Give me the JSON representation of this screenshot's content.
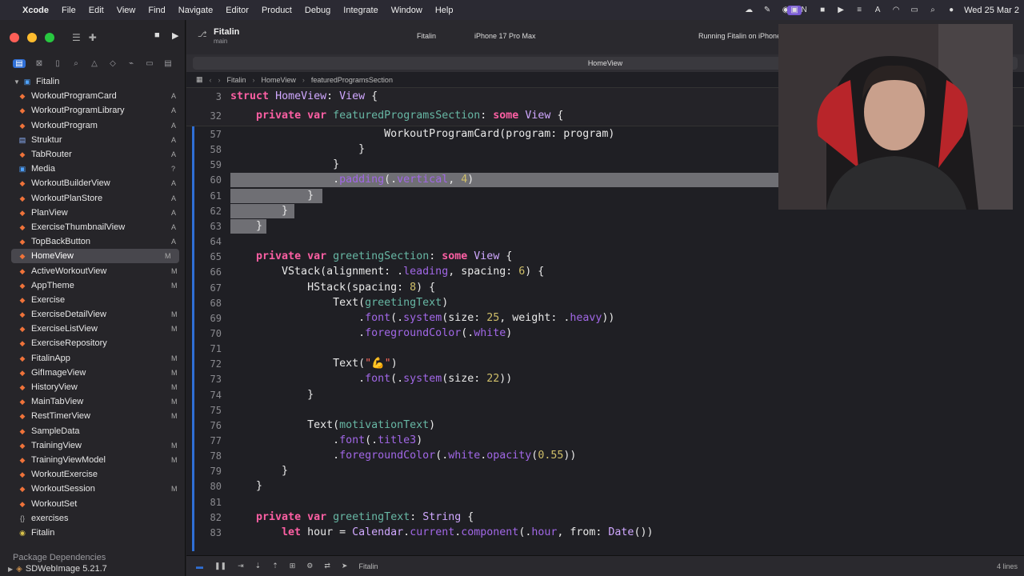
{
  "menubar": {
    "app": "Xcode",
    "items": [
      "File",
      "Edit",
      "View",
      "Find",
      "Navigate",
      "Editor",
      "Product",
      "Debug",
      "Integrate",
      "Window",
      "Help"
    ],
    "clock": "Wed 25 Mar 2"
  },
  "toolbar": {
    "project": "Fitalin",
    "branch": "main",
    "scheme": "Fitalin",
    "destination": "iPhone 17 Pro Max",
    "status": "Running Fitalin on iPhone"
  },
  "tab": {
    "name": "HomeView"
  },
  "jumpbar": [
    "Fitalin",
    "HomeView",
    "featuredProgramsSection"
  ],
  "navigator": {
    "root": "Fitalin",
    "files": [
      {
        "name": "WorkoutProgramCard",
        "status": "A",
        "kind": "swift"
      },
      {
        "name": "WorkoutProgramLibrary",
        "status": "A",
        "kind": "swift"
      },
      {
        "name": "WorkoutProgram",
        "status": "A",
        "kind": "swift"
      },
      {
        "name": "Struktur",
        "status": "A",
        "kind": "doc"
      },
      {
        "name": "TabRouter",
        "status": "A",
        "kind": "swift"
      },
      {
        "name": "Media",
        "status": "?",
        "kind": "assets"
      },
      {
        "name": "WorkoutBuilderView",
        "status": "A",
        "kind": "swift"
      },
      {
        "name": "WorkoutPlanStore",
        "status": "A",
        "kind": "swift"
      },
      {
        "name": "PlanView",
        "status": "A",
        "kind": "swift"
      },
      {
        "name": "ExerciseThumbnailView",
        "status": "A",
        "kind": "swift"
      },
      {
        "name": "TopBackButton",
        "status": "A",
        "kind": "swift"
      },
      {
        "name": "HomeView",
        "status": "M",
        "kind": "swift",
        "selected": true
      },
      {
        "name": "ActiveWorkoutView",
        "status": "M",
        "kind": "swift"
      },
      {
        "name": "AppTheme",
        "status": "M",
        "kind": "swift"
      },
      {
        "name": "Exercise",
        "status": "",
        "kind": "swift"
      },
      {
        "name": "ExerciseDetailView",
        "status": "M",
        "kind": "swift"
      },
      {
        "name": "ExerciseListView",
        "status": "M",
        "kind": "swift"
      },
      {
        "name": "ExerciseRepository",
        "status": "",
        "kind": "swift"
      },
      {
        "name": "FitalinApp",
        "status": "M",
        "kind": "swift"
      },
      {
        "name": "GifImageView",
        "status": "M",
        "kind": "swift"
      },
      {
        "name": "HistoryView",
        "status": "M",
        "kind": "swift"
      },
      {
        "name": "MainTabView",
        "status": "M",
        "kind": "swift"
      },
      {
        "name": "RestTimerView",
        "status": "M",
        "kind": "swift"
      },
      {
        "name": "SampleData",
        "status": "",
        "kind": "swift"
      },
      {
        "name": "TrainingView",
        "status": "M",
        "kind": "swift"
      },
      {
        "name": "TrainingViewModel",
        "status": "M",
        "kind": "swift"
      },
      {
        "name": "WorkoutExercise",
        "status": "",
        "kind": "swift"
      },
      {
        "name": "WorkoutSession",
        "status": "M",
        "kind": "swift"
      },
      {
        "name": "WorkoutSet",
        "status": "",
        "kind": "swift"
      },
      {
        "name": "exercises",
        "status": "",
        "kind": "json"
      },
      {
        "name": "Fitalin",
        "status": "",
        "kind": "target"
      }
    ],
    "packages_title": "Package Dependencies",
    "package": "SDWebImage 5.21.7"
  },
  "sticky": [
    {
      "num": "3",
      "code": "struct HomeView: View {"
    },
    {
      "num": "32",
      "code": "    private var featuredProgramsSection: some View {"
    }
  ],
  "code_lines": [
    {
      "num": "57",
      "code": "                        WorkoutProgramCard(program: program)",
      "hl": false
    },
    {
      "num": "58",
      "code": "                    }",
      "hl": false
    },
    {
      "num": "59",
      "code": "                }",
      "hl": false
    },
    {
      "num": "60",
      "code": "                .padding(.vertical, 4)",
      "hl": true
    },
    {
      "num": "61",
      "code": "            }",
      "hl": true
    },
    {
      "num": "62",
      "code": "        }",
      "hl": true
    },
    {
      "num": "63",
      "code": "    }",
      "hl": true
    },
    {
      "num": "64",
      "code": "",
      "hl": false
    },
    {
      "num": "65",
      "code": "    private var greetingSection: some View {",
      "hl": false
    },
    {
      "num": "66",
      "code": "        VStack(alignment: .leading, spacing: 6) {",
      "hl": false
    },
    {
      "num": "67",
      "code": "            HStack(spacing: 8) {",
      "hl": false
    },
    {
      "num": "68",
      "code": "                Text(greetingText)",
      "hl": false
    },
    {
      "num": "69",
      "code": "                    .font(.system(size: 25, weight: .heavy))",
      "hl": false
    },
    {
      "num": "70",
      "code": "                    .foregroundColor(.white)",
      "hl": false
    },
    {
      "num": "71",
      "code": "",
      "hl": false
    },
    {
      "num": "72",
      "code": "                Text(\"💪\")",
      "hl": false
    },
    {
      "num": "73",
      "code": "                    .font(.system(size: 22))",
      "hl": false
    },
    {
      "num": "74",
      "code": "            }",
      "hl": false
    },
    {
      "num": "75",
      "code": "",
      "hl": false
    },
    {
      "num": "76",
      "code": "            Text(motivationText)",
      "hl": false
    },
    {
      "num": "77",
      "code": "                .font(.title3)",
      "hl": false
    },
    {
      "num": "78",
      "code": "                .foregroundColor(.white.opacity(0.55))",
      "hl": false
    },
    {
      "num": "79",
      "code": "        }",
      "hl": false
    },
    {
      "num": "80",
      "code": "    }",
      "hl": false
    },
    {
      "num": "81",
      "code": "",
      "hl": false
    },
    {
      "num": "82",
      "code": "    private var greetingText: String {",
      "hl": false
    },
    {
      "num": "83",
      "code": "        let hour = Calendar.current.component(.hour, from: Date())",
      "hl": false
    }
  ],
  "debug": {
    "target": "Fitalin",
    "lines": "4 lines"
  },
  "colors": {
    "accent": "#2f6fd6",
    "keyword": "#fc5fa3",
    "selection": "#6f6f74"
  }
}
